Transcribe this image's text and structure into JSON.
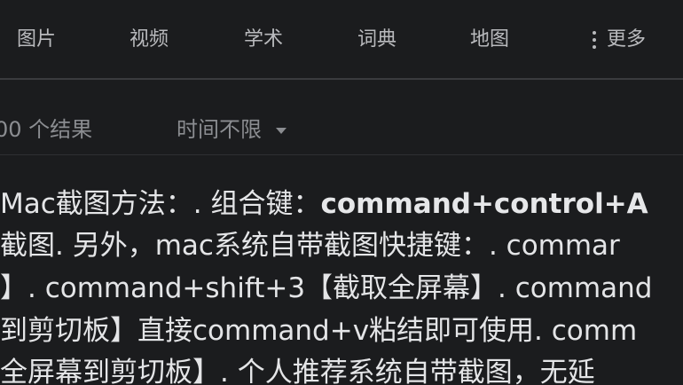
{
  "tabs": {
    "images": "图片",
    "videos": "视频",
    "academic": "学术",
    "dictionary": "词典",
    "maps": "地图",
    "more": "更多"
  },
  "tools": {
    "result_count": "00 个结果",
    "time_filter": "时间不限"
  },
  "snippet": {
    "line1_prefix": " Mac截图方法：. 组合键：",
    "line1_bold": "command+control+A",
    "line2": "截图. 另外，mac系统自带截图快捷键：. commar",
    "line3": "】. command+shift+3【截取全屏幕】. command",
    "line4": "到剪切板】直接command+v粘结即可使用. comm",
    "line5": "全屏幕到剪切板】. 个人推荐系统自带截图，无延"
  }
}
